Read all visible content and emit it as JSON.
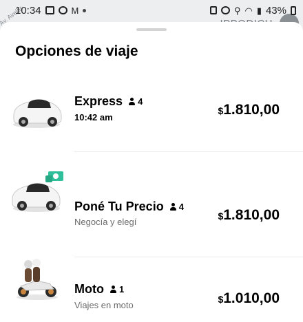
{
  "status_bar": {
    "time": "10:34",
    "battery": "43%"
  },
  "map": {
    "street_label": "Av. Avelar",
    "place_label": "IPPODICH"
  },
  "sheet": {
    "title": "Opciones de viaje"
  },
  "options": [
    {
      "name": "Express",
      "seats": "4",
      "subtitle": "10:42 am",
      "currency": "$",
      "price": "1.810,00",
      "thumb": "car-icon"
    },
    {
      "name": "Poné Tu Precio",
      "seats": "4",
      "subtitle": "Negocía y elegí",
      "currency": "$",
      "price": "1.810,00",
      "thumb": "car-with-money-icon"
    },
    {
      "name": "Moto",
      "seats": "1",
      "subtitle": "Viajes en moto",
      "currency": "$",
      "price": "1.010,00",
      "thumb": "motorbike-icon"
    }
  ],
  "colors": {
    "accent_money": "#2fbf9a",
    "subtitle_gray": "#6b6b6b"
  }
}
